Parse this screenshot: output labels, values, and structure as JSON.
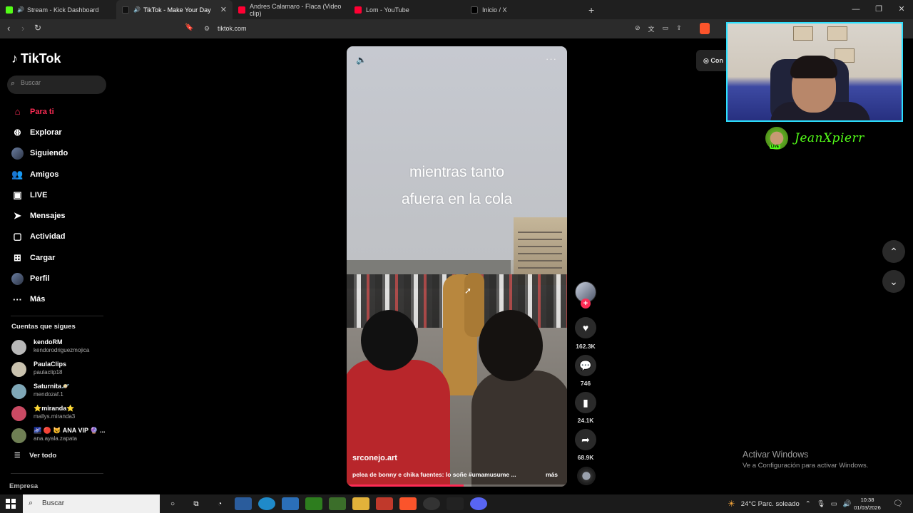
{
  "browser": {
    "tabs": [
      {
        "label": "Stream - Kick Dashboard",
        "favicon_color": "#53fc18",
        "speaker": true,
        "active": false
      },
      {
        "label": "TikTok - Make Your Day",
        "favicon_color": "#111111",
        "speaker": true,
        "active": true
      },
      {
        "label": "Andres Calamaro - Flaca (Video clip)",
        "favicon_color": "#ff0033",
        "speaker": false,
        "active": false
      },
      {
        "label": "Lom - YouTube",
        "favicon_color": "#ff0033",
        "speaker": false,
        "active": false
      },
      {
        "label": "Inicio / X",
        "favicon_color": "#000000",
        "speaker": false,
        "active": false
      }
    ],
    "url": "tiktok.com",
    "new_tab": "+"
  },
  "sidebar": {
    "logo": "TikTok",
    "search_placeholder": "Buscar",
    "nav": [
      {
        "label": "Para ti",
        "icon": "home-icon",
        "active": true
      },
      {
        "label": "Explorar",
        "icon": "compass-icon",
        "active": false
      },
      {
        "label": "Siguiendo",
        "icon": "avatar-icon",
        "active": false
      },
      {
        "label": "Amigos",
        "icon": "friends-icon",
        "active": false
      },
      {
        "label": "LIVE",
        "icon": "live-icon",
        "active": false
      },
      {
        "label": "Mensajes",
        "icon": "send-icon",
        "active": false
      },
      {
        "label": "Actividad",
        "icon": "activity-icon",
        "active": false
      },
      {
        "label": "Cargar",
        "icon": "upload-icon",
        "active": false
      },
      {
        "label": "Perfil",
        "icon": "profile-icon",
        "active": false
      },
      {
        "label": "Más",
        "icon": "more-icon",
        "active": false
      }
    ],
    "following_title": "Cuentas que sigues",
    "accounts": [
      {
        "name": "kendoRM",
        "username": "kendorodriguezmojica",
        "color": "#b8b8b8"
      },
      {
        "name": "PaulaClips",
        "username": "paulaclip18",
        "color": "#c9c2ae"
      },
      {
        "name": "Saturnita🪐",
        "username": "mendozaf.1",
        "color": "#7fa7b7"
      },
      {
        "name": "⭐miranda⭐",
        "username": "mallys.miranda3",
        "color": "#c94a63"
      },
      {
        "name": "🌌 🔴 😺 ANA VIP 🔮 ...",
        "username": "ana.ayala.zapata",
        "color": "#6f7f54"
      }
    ],
    "see_all": "Ver todo",
    "company": "Empresa"
  },
  "video": {
    "caption_line1": "mientras tanto",
    "caption_line2": "afuera en la cola",
    "author": "srconejo.art",
    "description": "pelea de bonny e chika fuentes: lo soñe #umamusume ...",
    "more": "más",
    "progress": 0.53
  },
  "actions": {
    "likes": "162.3K",
    "comments": "746",
    "saves": "24.1K",
    "shares": "68.9K"
  },
  "contact_label": "Con",
  "stream_overlay": {
    "streamer_name": "JeanXpierr",
    "live_badge": "LIVE"
  },
  "activate_windows": {
    "title": "Activar Windows",
    "subtitle": "Ve a Configuración para activar Windows."
  },
  "taskbar": {
    "search_label": "Buscar",
    "weather": "24°C  Parc. soleado",
    "time": "10:38",
    "date": "01/03/2026"
  }
}
